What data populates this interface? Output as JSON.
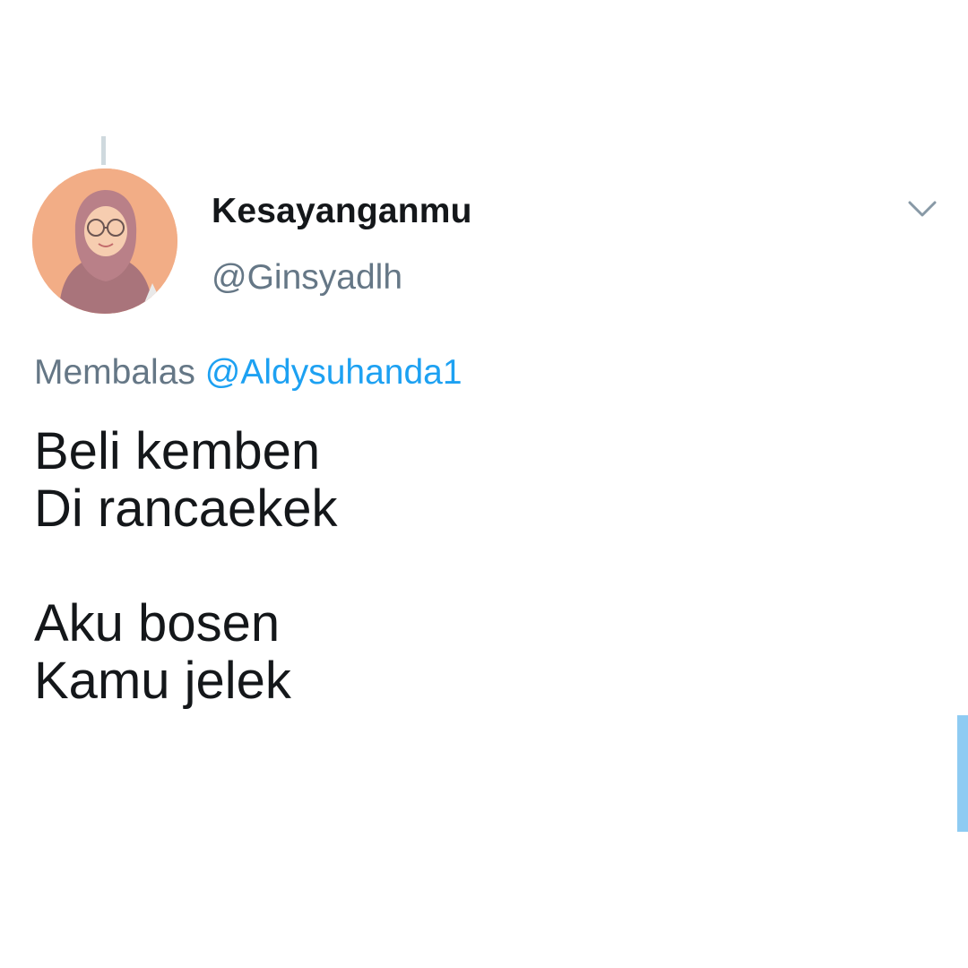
{
  "tweet": {
    "display_name": "Kesayanganmu",
    "handle": "@Ginsyadlh",
    "reply_prefix": "Membalas",
    "reply_to": "@Aldysuhanda1",
    "lines": [
      "Beli kemben",
      "Di rancaekek",
      "",
      "Aku bosen",
      "Kamu jelek"
    ]
  },
  "icons": {
    "menu": "chevron-down-icon"
  },
  "colors": {
    "text": "#14171a",
    "secondary": "#657786",
    "link": "#1da1f2",
    "avatar_background": "#f2ad86",
    "scrollbar": "#8ecbf2"
  }
}
